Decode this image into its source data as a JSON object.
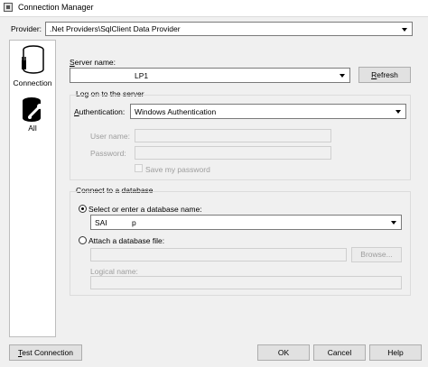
{
  "window": {
    "title": "Connection Manager"
  },
  "provider": {
    "label": "Provider:",
    "value": ".Net Providers\\SqlClient Data Provider"
  },
  "sidebar": {
    "items": [
      {
        "label": "Connection",
        "icon": "database-plug-icon"
      },
      {
        "label": "All",
        "icon": "database-wrench-icon"
      }
    ]
  },
  "server": {
    "label": "Server name:",
    "value": "LP1",
    "refresh_label": "Refresh"
  },
  "logon": {
    "group_label": "Log on to the server",
    "auth_label": "Authentication:",
    "auth_value": "Windows Authentication",
    "username_label": "User name:",
    "password_label": "Password:",
    "save_password_label": "Save my password"
  },
  "connect": {
    "group_label": "Connect to a database",
    "select_label": "Select or enter a database name:",
    "db_value_part1": "SAI",
    "db_value_part2": "p",
    "attach_label": "Attach a database file:",
    "browse_label": "Browse...",
    "logical_label": "Logical name:"
  },
  "footer": {
    "test_label": "Test Connection",
    "ok_label": "OK",
    "cancel_label": "Cancel",
    "help_label": "Help"
  }
}
